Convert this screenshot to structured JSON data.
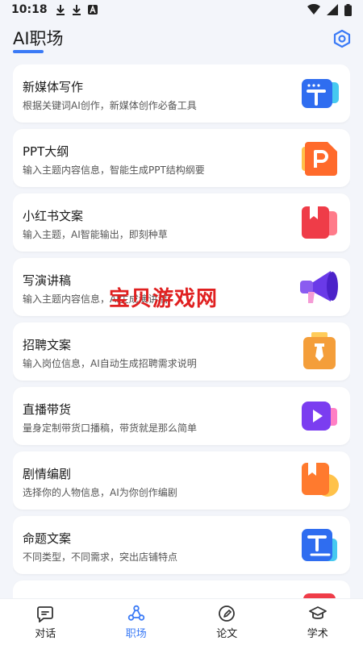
{
  "status_bar": {
    "time": "10:18"
  },
  "header": {
    "title": "AI职场",
    "accent": "#3a7af6"
  },
  "cards": [
    {
      "title": "新媒体写作",
      "desc": "根据关键词AI创作，新媒体创作必备工具",
      "icon": "text-t-icon"
    },
    {
      "title": "PPT大纲",
      "desc": "输入主题内容信息，智能生成PPT结构纲要",
      "icon": "ppt-icon"
    },
    {
      "title": "小红书文案",
      "desc": "输入主题，AI智能输出，即刻种草",
      "icon": "bookmark-red-icon"
    },
    {
      "title": "写演讲稿",
      "desc": "输入主题内容信息，AI生成演讲稿",
      "icon": "megaphone-icon"
    },
    {
      "title": "招聘文案",
      "desc": "输入岗位信息，AI自动生成招聘需求说明",
      "icon": "briefcase-icon"
    },
    {
      "title": "直播带货",
      "desc": "量身定制带货口播稿，带货就是那么简单",
      "icon": "video-play-icon"
    },
    {
      "title": "剧情编剧",
      "desc": "选择你的人物信息，AI为你创作编剧",
      "icon": "bookmark-orange-icon"
    },
    {
      "title": "命题文案",
      "desc": "不同类型，不同需求，突出店铺特点",
      "icon": "text-doc-icon"
    },
    {
      "title": "",
      "desc": "",
      "icon": "partial-icon"
    }
  ],
  "watermark": "宝贝游戏网",
  "tabs": [
    {
      "label": "对话",
      "icon": "chat-icon",
      "active": false
    },
    {
      "label": "职场",
      "icon": "workplace-icon",
      "active": true
    },
    {
      "label": "论文",
      "icon": "pen-icon",
      "active": false
    },
    {
      "label": "学术",
      "icon": "mortarboard-icon",
      "active": false
    }
  ]
}
